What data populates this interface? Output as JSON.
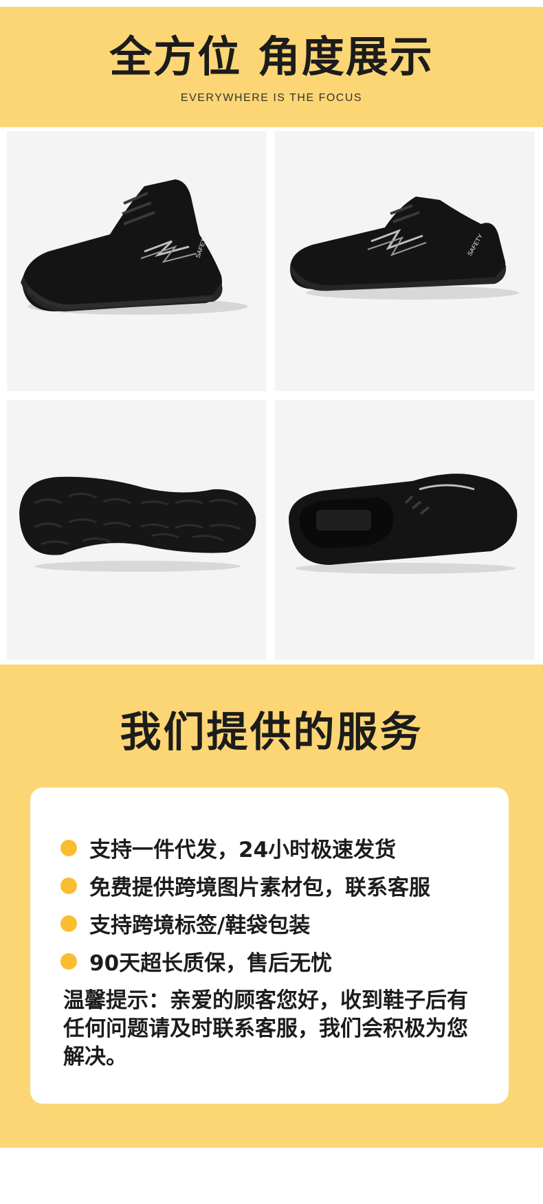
{
  "header": {
    "title": "全方位 角度展示",
    "subtitle": "EVERYWHERE IS THE FOCUS"
  },
  "gallery": {
    "views": [
      "side-view-left",
      "side-view-right",
      "sole-bottom-view",
      "top-view"
    ],
    "shoe_text": "SAFETY"
  },
  "services": {
    "title": "我们提供的服务",
    "items": [
      "支持一件代发，24小时极速发货",
      "免费提供跨境图片素材包，联系客服",
      "支持跨境标签/鞋袋包装",
      "90天超长质保，售后无忧"
    ],
    "tip": "温馨提示：亲爱的顾客您好，收到鞋子后有任何问题请及时联系客服，我们会积极为您解决。"
  },
  "colors": {
    "band": "#fcd674",
    "bullet": "#fbbd30",
    "text": "#1c1c1c",
    "tile_bg": "#f4f4f4"
  }
}
